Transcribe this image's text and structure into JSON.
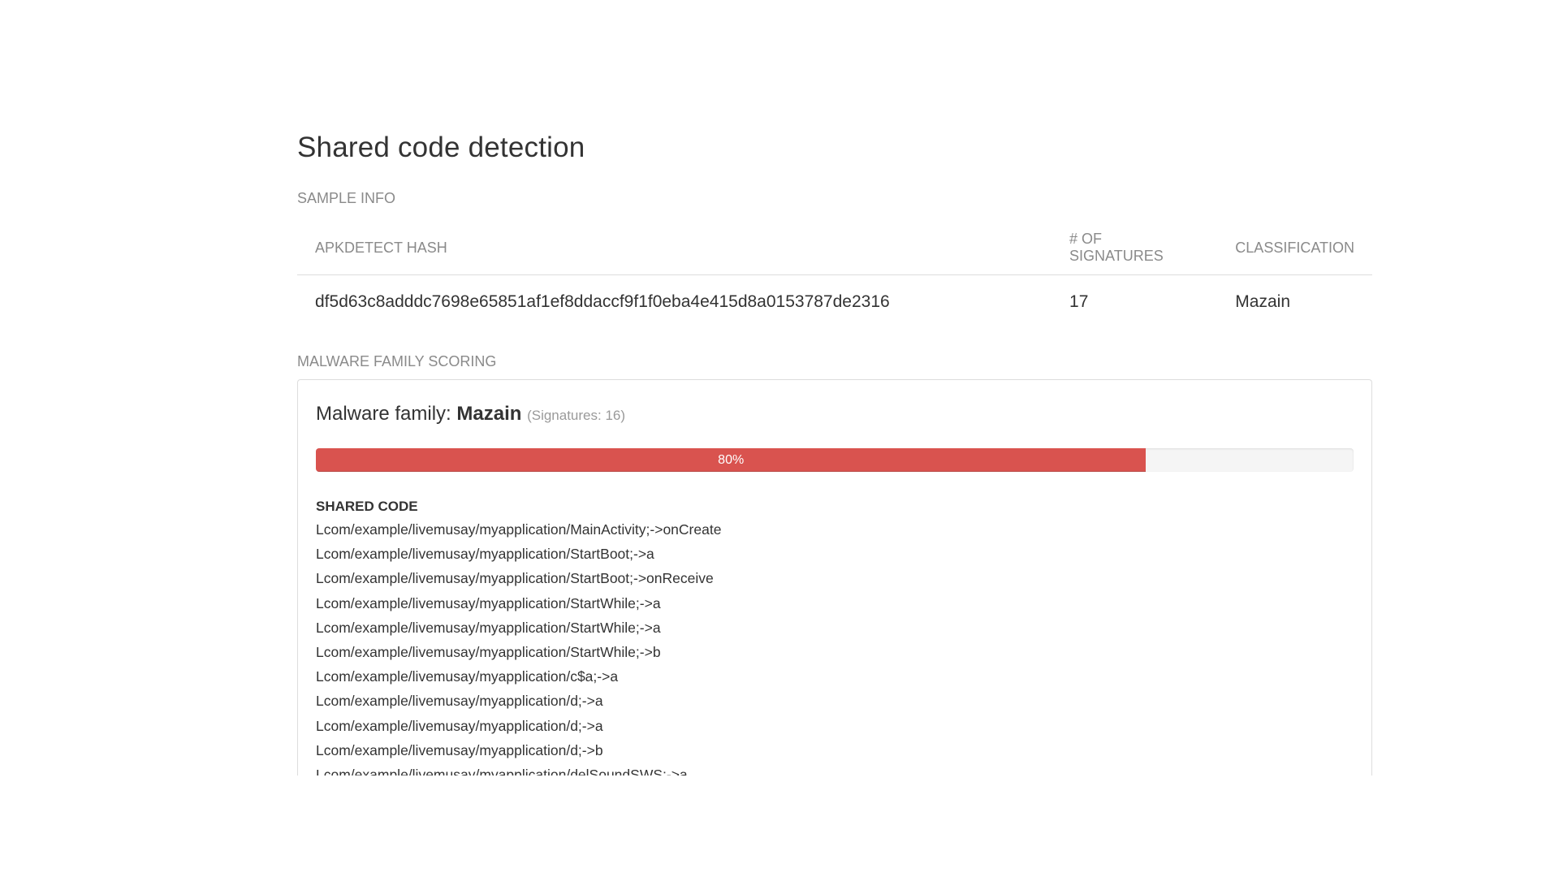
{
  "page": {
    "title": "Shared code detection"
  },
  "sample_info": {
    "section_label": "SAMPLE INFO",
    "columns": {
      "hash": "APKDETECT HASH",
      "signatures": "# OF SIGNATURES",
      "classification": "CLASSIFICATION"
    },
    "row": {
      "hash": "df5d63c8adddc7698e65851af1ef8ddaccf9f1f0eba4e415d8a0153787de2316",
      "signatures": "17",
      "classification": "Mazain"
    }
  },
  "scoring": {
    "section_label": "MALWARE FAMILY SCORING",
    "family_prefix": "Malware family: ",
    "family_name": "Mazain",
    "family_meta": "(Signatures: 16)",
    "progress_label": "80%",
    "progress_fraction": 0.8,
    "progress_color": "#d9534f",
    "shared_code_heading": "SHARED CODE",
    "shared_code": [
      "Lcom/example/livemusay/myapplication/MainActivity;->onCreate",
      "Lcom/example/livemusay/myapplication/StartBoot;->a",
      "Lcom/example/livemusay/myapplication/StartBoot;->onReceive",
      "Lcom/example/livemusay/myapplication/StartWhile;->a",
      "Lcom/example/livemusay/myapplication/StartWhile;->a",
      "Lcom/example/livemusay/myapplication/StartWhile;->b",
      "Lcom/example/livemusay/myapplication/c$a;->a",
      "Lcom/example/livemusay/myapplication/d;->a",
      "Lcom/example/livemusay/myapplication/d;->a",
      "Lcom/example/livemusay/myapplication/d;->b",
      "Lcom/example/livemusay/myapplication/delSoundSWS;->a"
    ]
  }
}
